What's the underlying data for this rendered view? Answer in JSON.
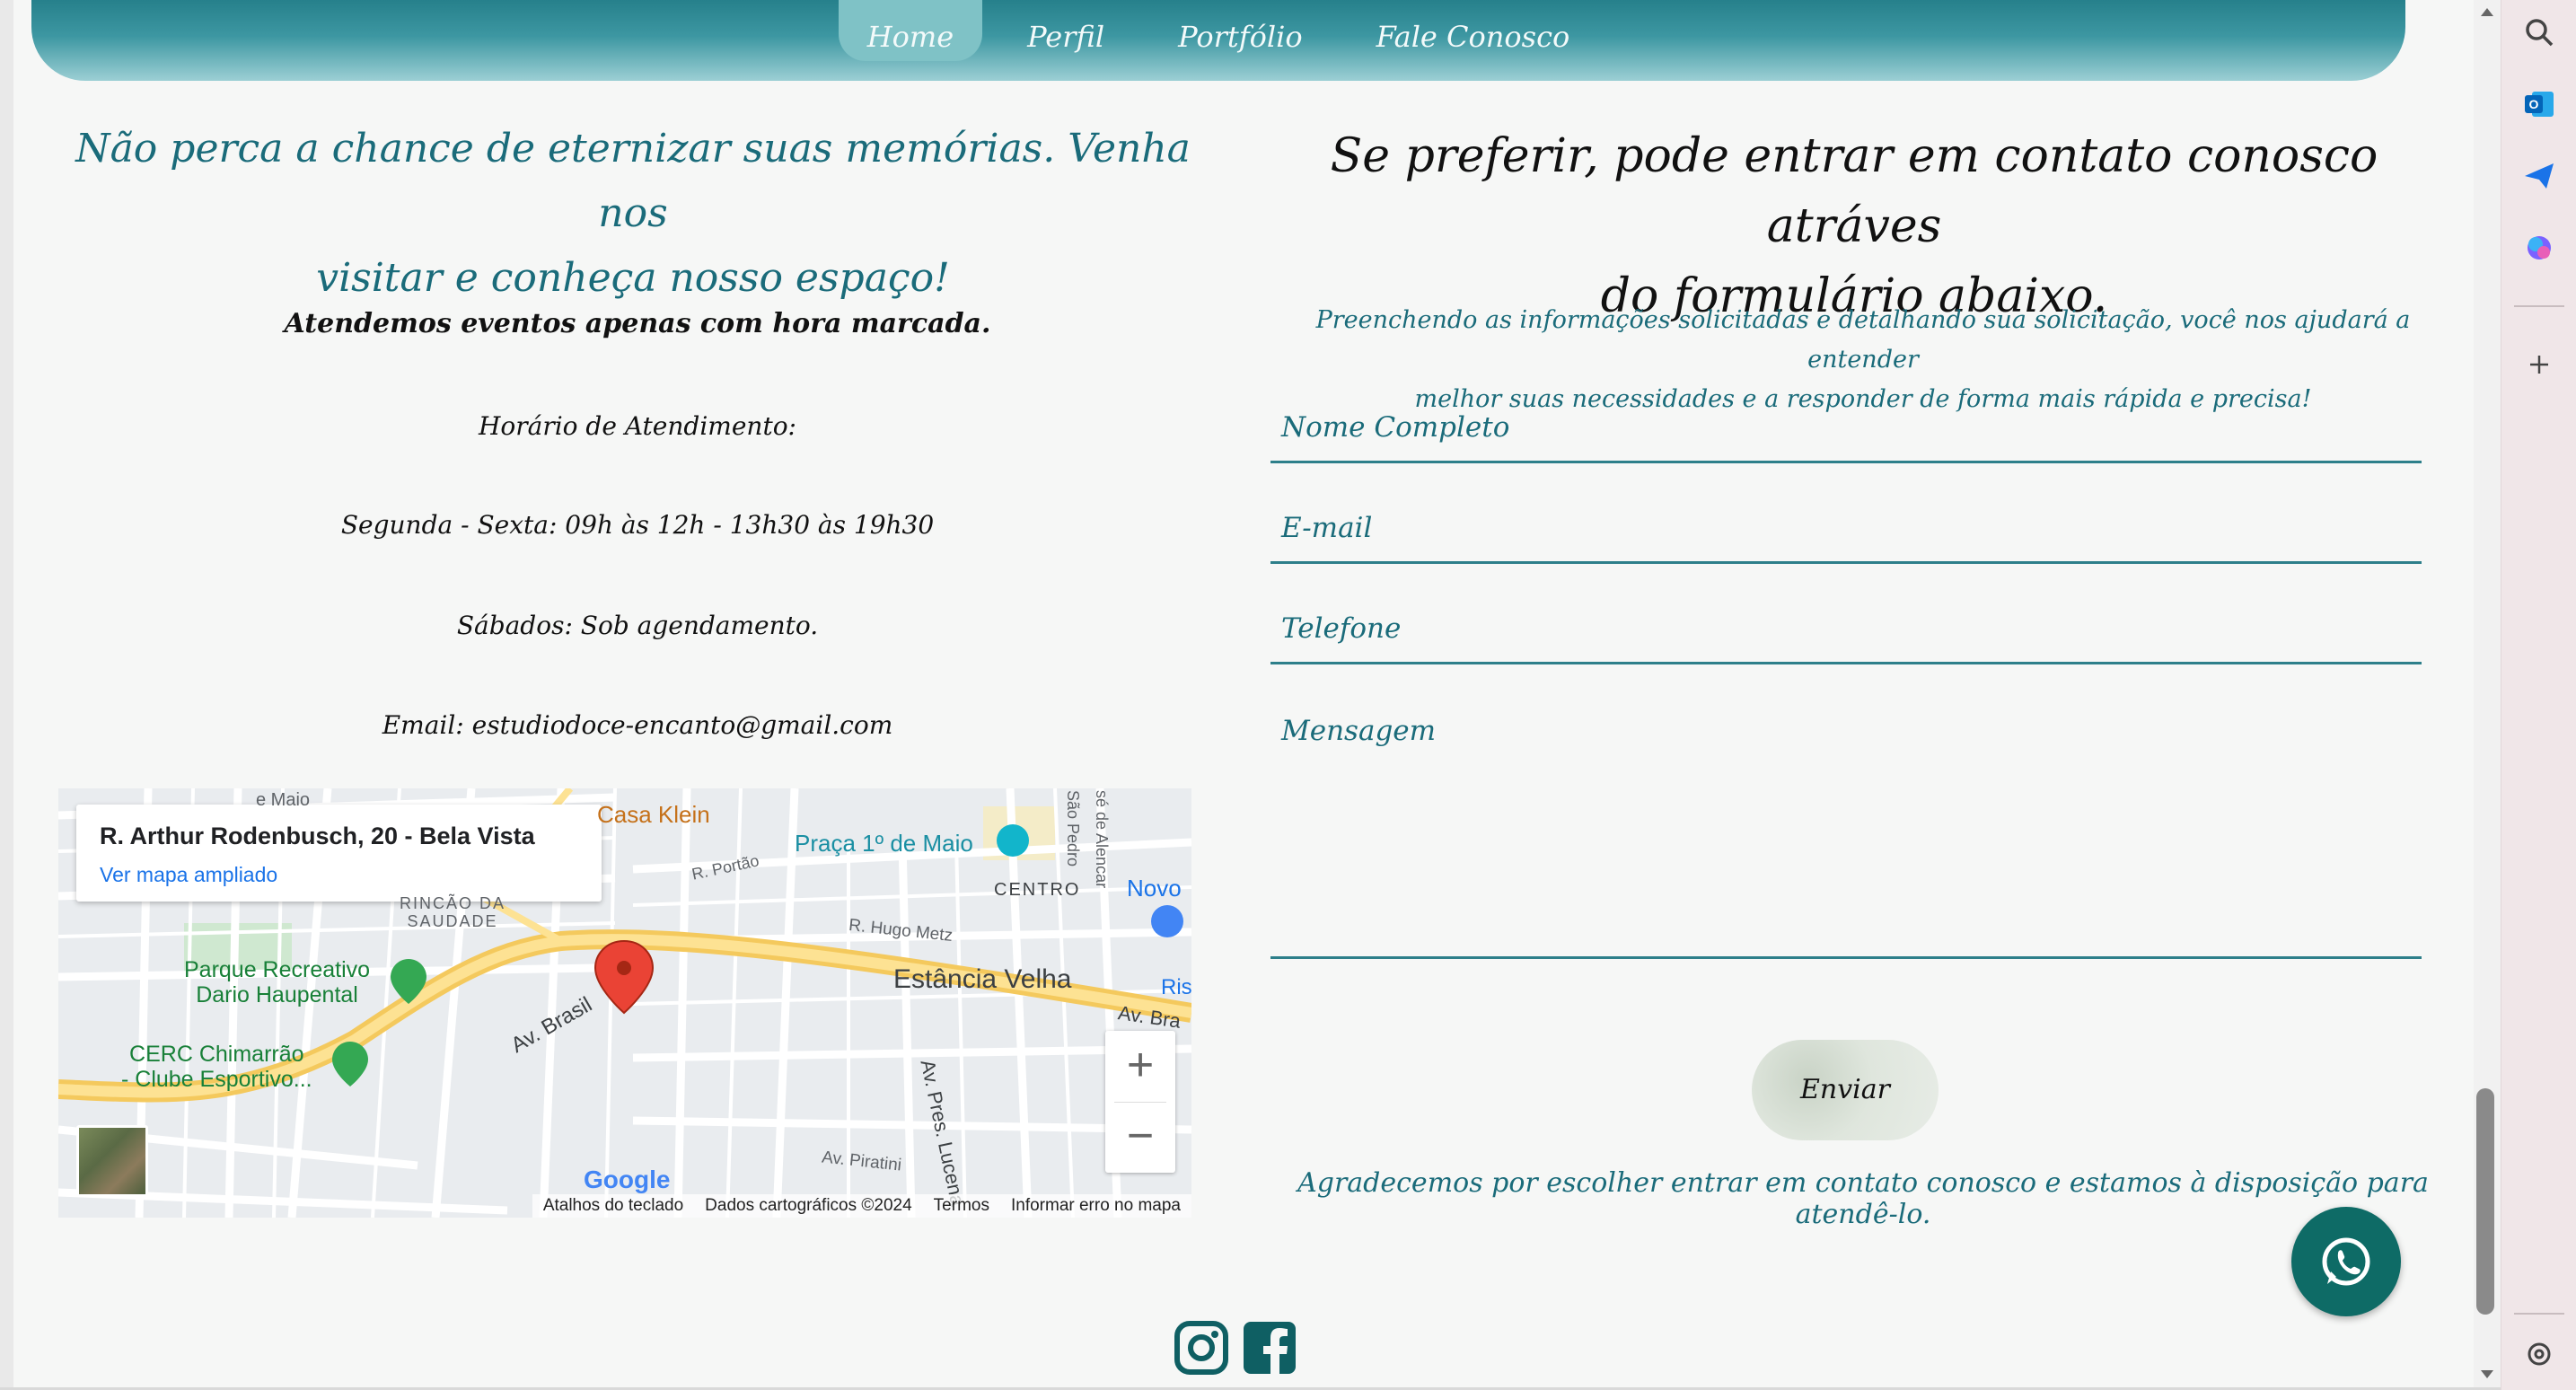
{
  "nav": {
    "items": [
      {
        "label": "Home",
        "active": true
      },
      {
        "label": "Perfil",
        "active": false
      },
      {
        "label": "Portfólio",
        "active": false
      },
      {
        "label": "Fale Conosco",
        "active": false
      }
    ]
  },
  "left": {
    "title_line1": "Não perca a chance de eternizar suas memórias. Venha nos",
    "title_line2": "visitar e conheça nosso espaço!",
    "events": "Atendemos eventos apenas com hora marcada.",
    "hours_label": "Horário de Atendimento:",
    "weekdays": "Segunda - Sexta: 09h às 12h - 13h30 às 19h30",
    "saturdays": "Sábados: Sob agendamento.",
    "email": "Email: estudiodoce-encanto@gmail.com"
  },
  "map": {
    "address": "R. Arthur Rodenbusch, 20 - Bela Vista",
    "link": "Ver mapa ampliado",
    "labels": {
      "casa_klein": "Casa Klein",
      "praca": "Praça 1º de Maio",
      "centro": "CENTRO",
      "novo": "Novo",
      "ris": "Ris",
      "estancia": "Estância Velha",
      "av_brasil": "Av. Brasil",
      "av_bra": "Av. Bra",
      "parque1": "Parque Recreativo",
      "parque2": "Dario Haupental",
      "cerc1": "CERC Chimarrão",
      "cerc2": "- Clube Esportivo...",
      "saudade": "SAUDADE",
      "rincao": "RINCÃO DA",
      "r_portao": "R. Portão",
      "r_hugo": "R. Hugo Metz",
      "av_piratini": "Av. Piratini",
      "av_pres": "Av. Pres. Lucena",
      "maio": "e Maio",
      "sao_pedro": "São Pedro",
      "jose_alencar": "sé de Alencar"
    },
    "google": "Google",
    "footer": [
      "Atalhos do teclado",
      "Dados cartográficos ©2024",
      "Termos",
      "Informar erro no mapa"
    ],
    "zoom_in": "+",
    "zoom_out": "−"
  },
  "right": {
    "title_line1": "Se preferir, pode entrar em contato conosco atráves",
    "title_line2": "do formulário abaixo.",
    "desc_line1": "Preenchendo as informações solicitadas e detalhando sua solicitação, você nos ajudará a entender",
    "desc_line2": "melhor suas necessidades e a responder de forma mais rápida e precisa!",
    "fields": {
      "name": "Nome Completo",
      "email": "E-mail",
      "phone": "Telefone",
      "message": "Mensagem"
    },
    "send": "Enviar",
    "thanks": "Agradecemos por escolher entrar em contato conosco e estamos à disposição para atendê-lo."
  },
  "colors": {
    "teal": "#1a6b7a",
    "nav_dark": "#1b7580",
    "whatsapp": "#0e6b66"
  }
}
